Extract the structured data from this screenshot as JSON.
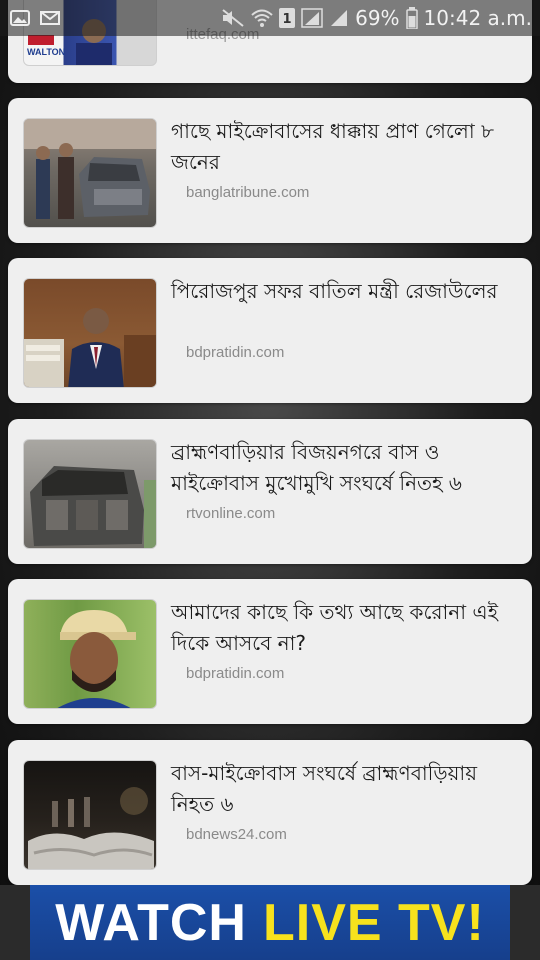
{
  "status_bar": {
    "icons_left": [
      "image-icon",
      "mail-icon"
    ],
    "icons_right": [
      "mute-icon",
      "wifi-icon",
      "sim1-icon",
      "signal-icon",
      "signal-icon"
    ],
    "sim_label": "1",
    "battery": "69%",
    "time": "10:42 a.m."
  },
  "feed": {
    "partial_item": {
      "source": "ittefaq.com",
      "logo_text": "WALTON"
    },
    "items": [
      {
        "headline": "গাছে মাইক্রোবাসের ধাক্কায় প্রাণ গেলো ৮ জনের",
        "source": "banglatribune.com"
      },
      {
        "headline": "পিরোজপুর সফর বাতিল মন্ত্রী রেজাউলের",
        "source": "bdpratidin.com"
      },
      {
        "headline": "ব্রাহ্মণবাড়িয়ার বিজয়নগরে বাস ও মাইক্রোবাস মুখোমুখি সংঘর্ষে নিতহ ৬",
        "source": "rtvonline.com"
      },
      {
        "headline": "আমাদের কাছে কি তথ্য আছে করোনা এই দিকে আসবে না?",
        "source": "bdpratidin.com"
      },
      {
        "headline": "বাস-মাইক্রোবাস সংঘর্ষে ব্রাহ্মণবাড়িয়ায় নিহত ৬",
        "source": "bdnews24.com"
      }
    ]
  },
  "banner": {
    "word1": "WATCH",
    "word2": "LIVE TV!"
  },
  "colors": {
    "card_bg": "#efefef",
    "banner_blue": "#1b4fa8",
    "banner_yellow": "#f7e21d"
  }
}
